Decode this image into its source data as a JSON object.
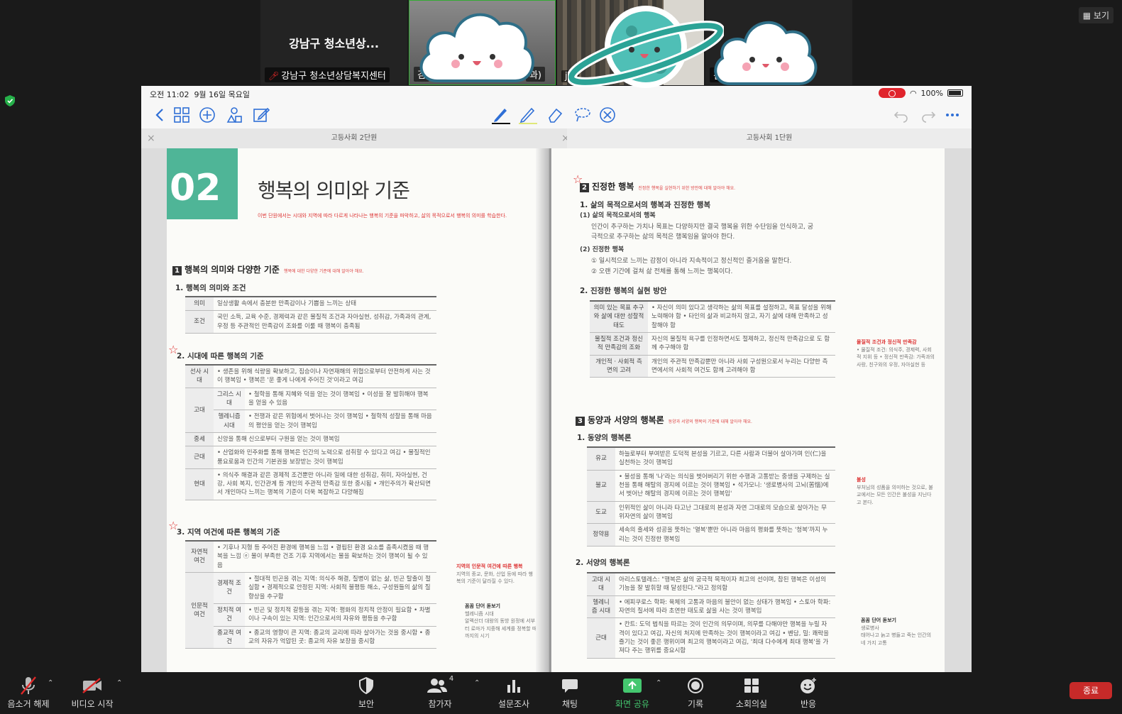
{
  "participants": {
    "tile1": {
      "big_name": "강남구 청소년상...",
      "label": "강남구 청소년상담복지센터"
    },
    "tile2": {
      "label": "김",
      "label_suffix": "과)"
    },
    "tile3": {
      "label": "jin"
    },
    "tile4": {
      "label": "김"
    }
  },
  "view_button": "보기",
  "ipad": {
    "time": "오전 11:02",
    "date": "9월 16일 목요일",
    "battery": "100%"
  },
  "tabs": {
    "left": "고등사회 2단원",
    "right": "고등사회 1단원"
  },
  "left_page": {
    "badge": "02",
    "title": "행복의 의미와 기준",
    "intro": "이번 단원에서는 시대와 지역에 따라 다르게 나타나는 행복의 기준을 파악하고, 삶의 목적으로서 행복의 의미를 학습한다.",
    "sec1": {
      "num": "1",
      "title": "행복의 의미와 다양한 기준",
      "note": "행복에 대한 다양한 기준에 대해 알아야 해요."
    },
    "sub1": "1. 행복의 의미와 조건",
    "table1": [
      {
        "k": "의미",
        "v": "일상생활 속에서 충분한 만족감이나 기쁨을 느끼는 상태"
      },
      {
        "k": "조건",
        "v": "국민 소득, 교육 수준, 경제력과 같은 물질적 조건과 자아실현, 성취감, 가족과의 관계, 우정 등 주관적인 만족감이 조화를 이룰 때 행복이 충족됨"
      }
    ],
    "sub2": "2. 시대에 따른 행복의 기준",
    "table2": [
      {
        "k": "선사 시대",
        "v": "• 생존을 위해 식량을 확보하고, 짐승이나 자연재해의 위협으로부터 안전하게 사는 것이 행복임 • 행복은 '운 좋게 나에게 주어진 것'이라고 여김"
      },
      {
        "k": "고대",
        "k2": "그리스 시대",
        "v": "• 철학을 통해 지혜와 덕을 얻는 것이 행복임 • 이성을 잘 발휘해야 행복을 얻을 수 있음"
      },
      {
        "k": "",
        "k2": "헬레니즘 시대",
        "v": "• 전쟁과 같은 위험에서 벗어나는 것이 행복임 • 철학적 성찰을 통해 마음의 평안을 얻는 것이 행복임"
      },
      {
        "k": "중세",
        "v": "신앙을 통해 신으로부터 구원을 얻는 것이 행복임"
      },
      {
        "k": "근대",
        "v": "• 산업화와 민주화를 통해 행복은 인간의 노력으로 성취할 수 있다고 여김 • 물질적인 풍요로움과 인간의 기본권을 보장받는 것이 행복임"
      },
      {
        "k": "현대",
        "v": "• 의식주 해결과 같은 경제적 조건뿐만 아니라 일에 대한 성취감, 취미, 자아실현, 건강, 사회 복지, 인간관계 등 개인의 주관적 만족감 또한 중시됨 • 개인주의가 확산되면서 개인마다 느끼는 행복의 기준이 더욱 복잡하고 다양해짐"
      }
    ],
    "sub3": "3. 지역 여건에 따른 행복의 기준",
    "table3": [
      {
        "k": "자연적 여건",
        "v": "• 기후나 지형 등 주어진 환경에 행복을 느낌 • 결핍된 환경 요소를 충족시켰을 때 행복을 느낌 ⓔ 물이 부족한 건조 기후 지역에서는 물을 확보하는 것이 행복이 될 수 있음"
      },
      {
        "k": "인문적 여건",
        "k2": "경제적 조건",
        "v": "• 절대적 빈곤을 겪는 지역: 의식주 해결, 질병이 없는 삶, 빈곤 탈출이 절실함 • 경제적으로 안정된 지역: 사회적 불평등 해소, 구성원들의 삶의 질 향상을 추구함"
      },
      {
        "k": "",
        "k2": "정치적 여건",
        "v": "• 빈곤 및 정치적 갈등을 겪는 지역: 평화의 정치적 안정이 필요함 • 차별이나 구속이 있는 지역: 인간으로서의 자유와 평등을 추구함"
      },
      {
        "k": "",
        "k2": "종교적 여건",
        "v": "• 종교의 영향이 큰 지역: 종교의 교리에 따라 살아가는 것을 중시함 • 종교의 자유가 억압된 곳: 종교의 자유 보장을 중시함"
      }
    ],
    "side1": {
      "title": "지역의 인문적 여건에 따른 행복",
      "text": "지역의 종교, 문화, 산업 등에 따라 행복의 기준이 달라질 수 있다."
    },
    "side2": {
      "title": "꼼꼼 단어 돋보기",
      "word": "헬레니즘 시대",
      "text": "알렉산더 대왕의 동방 원정에 서부터 로마가 지중해 세계를 정복할 때까지의 시기"
    }
  },
  "right_page": {
    "sec2": {
      "num": "2",
      "title": "진정한 행복",
      "note": "진정한 행복을 실현하기 위한 방안에 대해 알아야 해요."
    },
    "sub1": "1. 삶의 목적으로서의 행복과 진정한 행복",
    "p1_h": "(1) 삶의 목적으로서의 행복",
    "p1_t1": "인간이 추구하는 가치나 목표는 다양하지만 결국 행복을 위한 수단임을 인식하고, 궁",
    "p1_t2": "극적으로 추구하는 삶의 목적은 행복임을 알아야 한다.",
    "p2_h": "(2) 진정한 행복",
    "p2_t1": "① 일시적으로 느끼는 감정이 아니라 지속적이고 정신적인 즐거움을 말한다.",
    "p2_t2": "② 오랜 기간에 걸쳐 삶 전체를 통해 느끼는 행복이다.",
    "sub2": "2. 진정한 행복의 실현 방안",
    "table1": [
      {
        "k": "의미 있는 목표 추구와 삶에 대한 성찰적 태도",
        "v": "• 자신이 의미 있다고 생각하는 삶의 목표를 설정하고, 목표 달성을 위해 노력해야 함 • 타인의 삶과 비교하지 않고, 자기 삶에 대해 만족하고 성찰해야 함"
      },
      {
        "k": "물질적 조건과 정신적 만족감의 조화",
        "v": "자신의 물질적 욕구를 인정하면서도 절제하고, 정신적 만족감으로 도 함께 추구해야 함"
      },
      {
        "k": "개인적 · 사회적 측면의 고려",
        "v": "개인의 주관적 만족감뿐만 아니라 사회 구성원으로서 누리는 다양한 측면에서의 사회적 여건도 함께 고려해야 함"
      }
    ],
    "side1": {
      "title": "물질적 조건과 정신적 만족감",
      "text": "• 물질적 조건: 의식주, 경제력, 사회적 지위 등 • 정신적 만족감: 가족과의 사랑, 친구와의 우정, 자아실현 등"
    },
    "sec3": {
      "num": "3",
      "title": "동양과 서양의 행복론",
      "note": "동양과 서양의 행복의 기준에 대해 알아야 해요."
    },
    "sub3": "1. 동양의 행복론",
    "table2": [
      {
        "k": "유교",
        "v": "하늘로부터 부여받은 도덕적 본성을 기르고, 다른 사람과 더불어 살아가며 인(仁)을 실천하는 것이 행복임"
      },
      {
        "k": "불교",
        "v": "• 불성을 통해 '나'라는 의식을 벗어버리기 위한 수행과 고통받는 중생을 구제하는 실천을 통해 해탈의 경지에 이르는 것이 행복임 • 석가모니: '생로병사의 고뇌(苦惱)에서 벗어난 해탈의 경지에 이르는 것이 행복임'"
      },
      {
        "k": "도교",
        "v": "인위적인 삶이 아니라 타고난 그대로의 본성과 자연 그대로의 모습으로 살아가는 무위자연의 삶이 행복임"
      },
      {
        "k": "정약용",
        "v": "세속의 출세와 성공을 뜻하는 '열복'뿐만 아니라 마음의 평화를 뜻하는 '청복'까지 누리는 것이 진정한 행복임"
      }
    ],
    "side2": {
      "title": "불성",
      "text": "부처님의 성품을 의미하는 것으로, 불교에서는 모든 인간은 불성을 지닌다고 본다."
    },
    "sub4": "2. 서양의 행복론",
    "table3": [
      {
        "k": "고대 시대",
        "v": "아리스토텔레스: \"행복은 삶의 궁극적 목적이자 최고의 선이며, 참된 행복은 이성의 기능을 잘 발휘할 때 달성된다.\"라고 정의함"
      },
      {
        "k": "헬레니즘 시대",
        "v": "• 에피쿠로스 학파: 육체의 고통과 마음의 불안이 없는 상태가 행복임 • 스토아 학파: 자연의 질서에 따라 초연한 태도로 삶을 사는 것이 행복임"
      },
      {
        "k": "근대",
        "v": "• 칸트: 도덕 법칙을 따르는 것이 인간의 의무이며, 의무를 다해야만 행복을 누릴 자격이 있다고 여김, 자신의 처지에 만족하는 것이 행복이라고 여김 • 벤담, 밀: 쾌락을 즐기는 것이 좋은 행위이며 최고의 행복이라고 여김, '최대 다수에게 최대 행복'을 가져다 주는 행위를 중요시함"
      }
    ],
    "side3": {
      "title": "꼼꼼 단어 돋보기",
      "word": "생로병사",
      "text": "태어나고 늙고 병들고 죽는 인간의 네 가지 고통"
    }
  },
  "toolbar": {
    "mute": "음소거 해제",
    "video": "비디오 시작",
    "security": "보안",
    "participants": "참가자",
    "participants_count": "4",
    "polls": "설문조사",
    "chat": "채팅",
    "share": "화면 공유",
    "record": "기록",
    "breakout": "소회의실",
    "reactions": "반응",
    "end": "종료"
  },
  "colors": {
    "accent_green": "#44c76f",
    "end_red": "#c72a29",
    "badge_teal": "#4fb597",
    "note_red": "#d33333"
  }
}
